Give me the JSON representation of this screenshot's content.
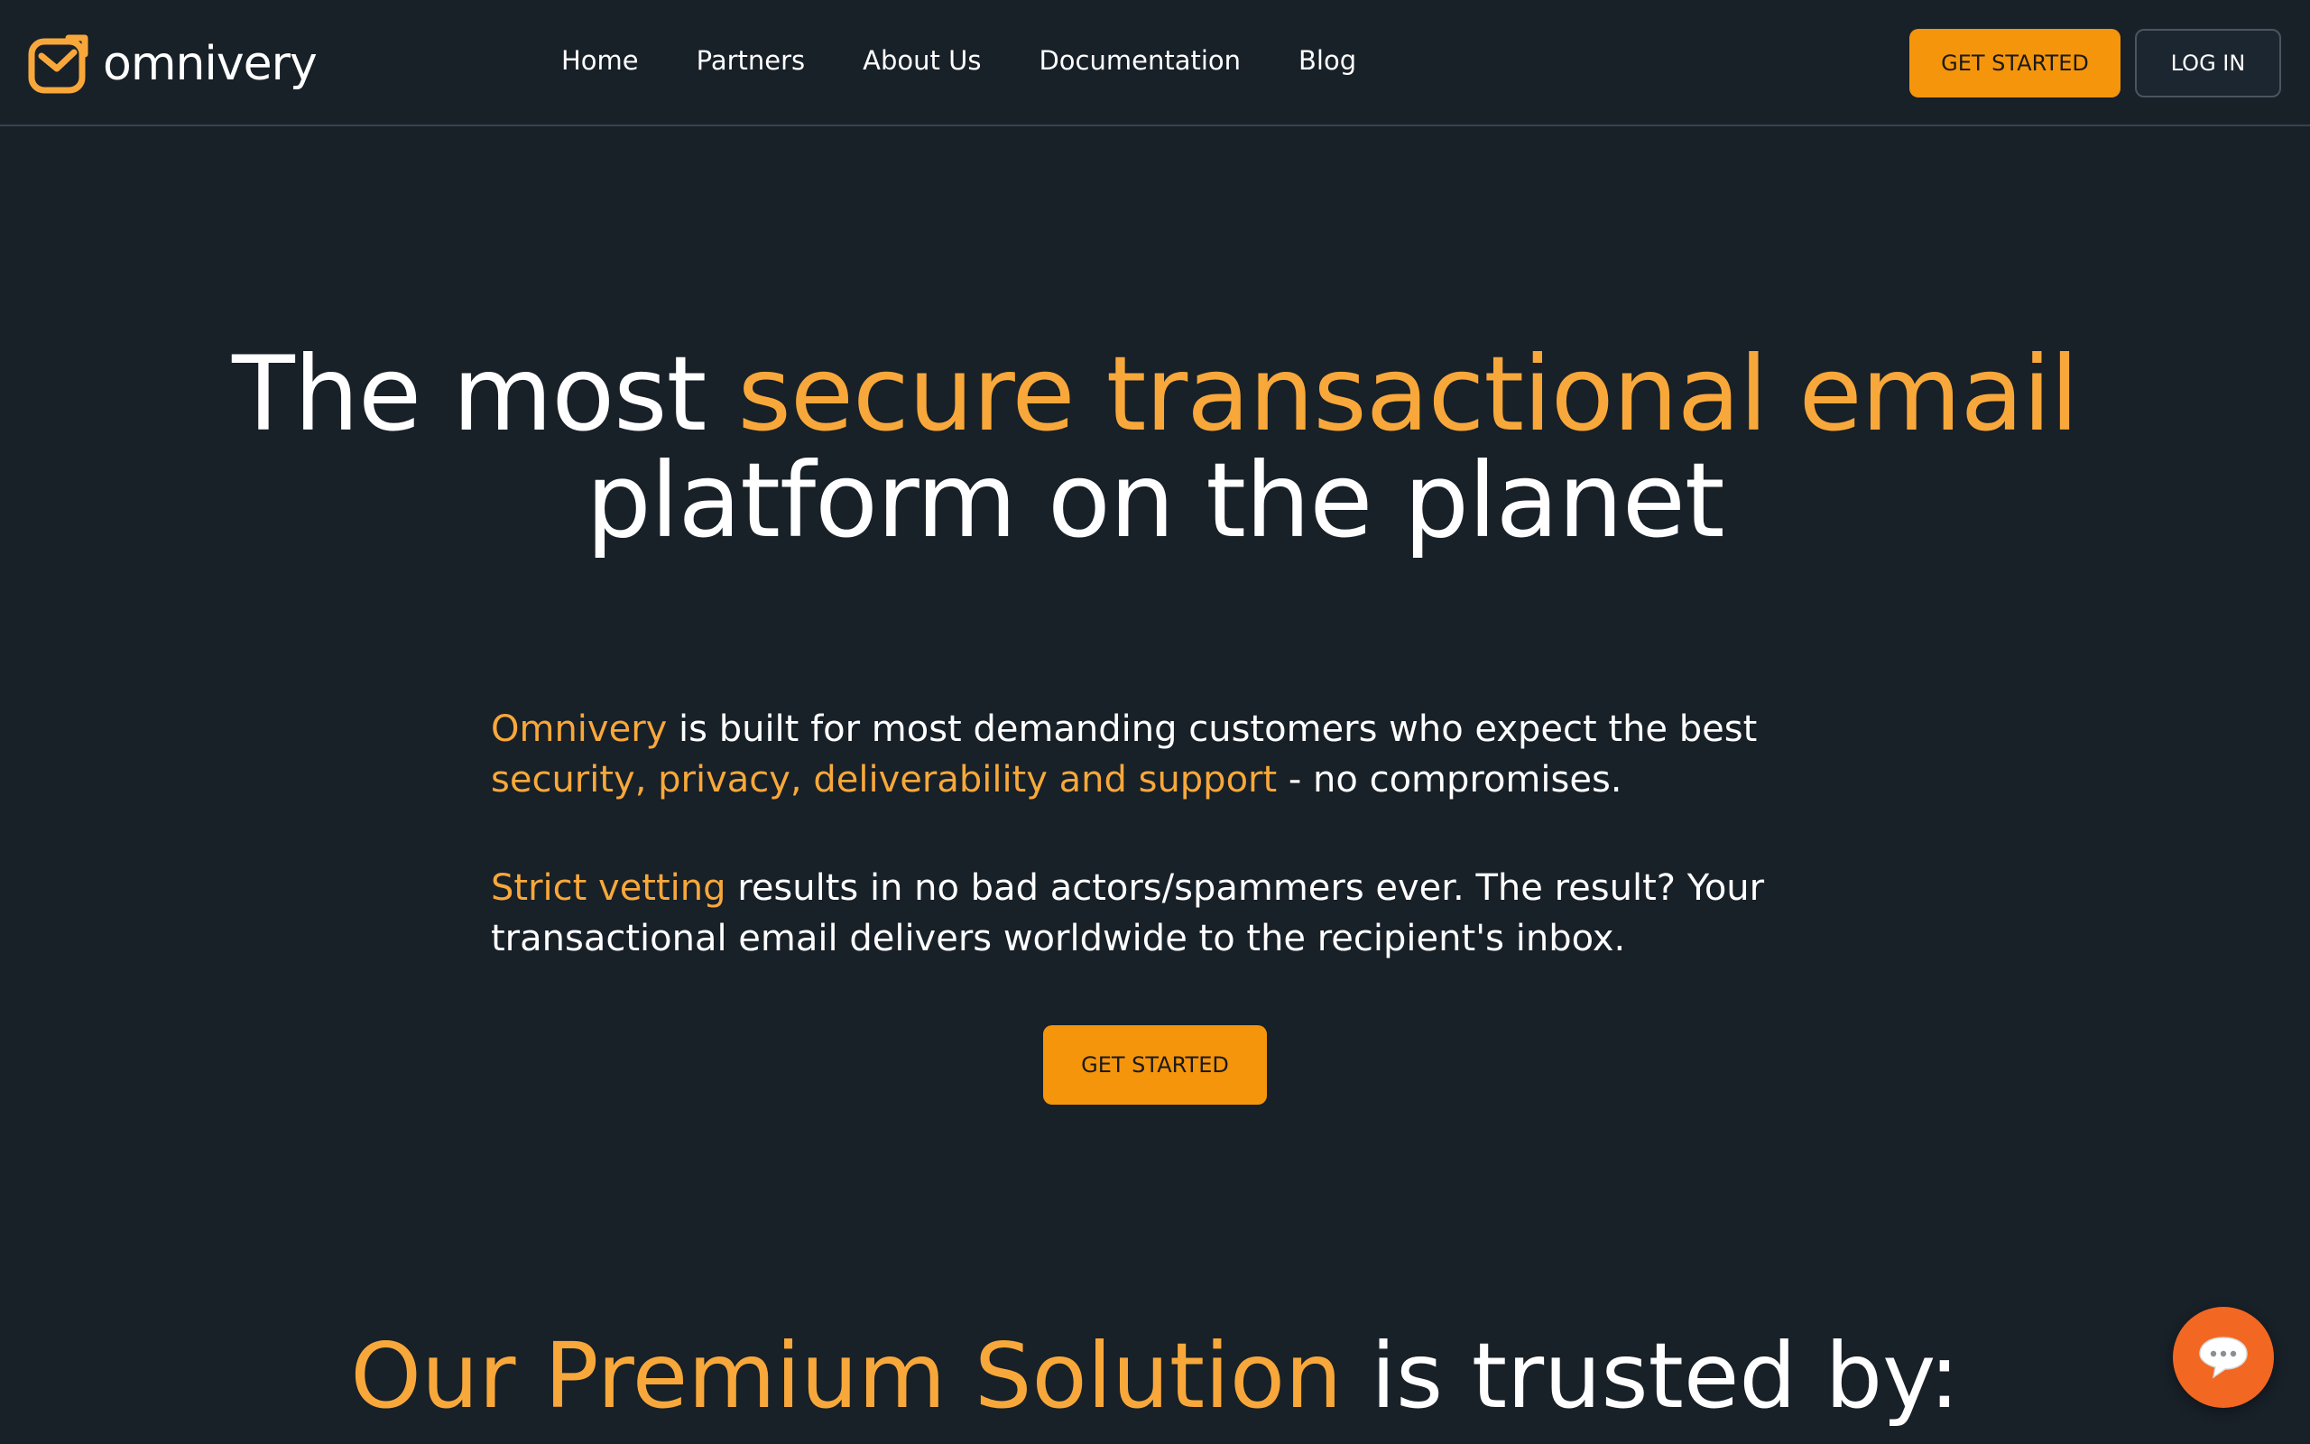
{
  "brand": {
    "name": "omnivery",
    "logo_icon": "envelope-arrow-icon",
    "accent_color": "#f8a83a",
    "button_color": "#f5950c",
    "background_color": "#182028"
  },
  "nav": {
    "items": [
      {
        "label": "Home"
      },
      {
        "label": "Partners"
      },
      {
        "label": "About Us"
      },
      {
        "label": "Documentation"
      },
      {
        "label": "Blog"
      }
    ]
  },
  "header_actions": {
    "get_started_label": "GET STARTED",
    "login_label": "LOG IN"
  },
  "hero": {
    "title_part1": "The most ",
    "title_accent": "secure transactional email",
    "title_part2": "platform on the planet",
    "p1_accent1": "Omnivery",
    "p1_text1": " is built for most demanding customers who expect the best ",
    "p1_accent2": "security, privacy, deliverability and support",
    "p1_text2": " - no compromises.",
    "p2_accent": "Strict vetting",
    "p2_text": " results in no bad actors/spammers ever. The result? Your transactional email delivers worldwide to the recipient's inbox.",
    "cta_label": "GET STARTED"
  },
  "trusted": {
    "title_accent": "Our Premium Solution",
    "title_rest": " is trusted by:"
  },
  "chat": {
    "icon": "chat-bubble-icon",
    "color": "#f26722"
  }
}
